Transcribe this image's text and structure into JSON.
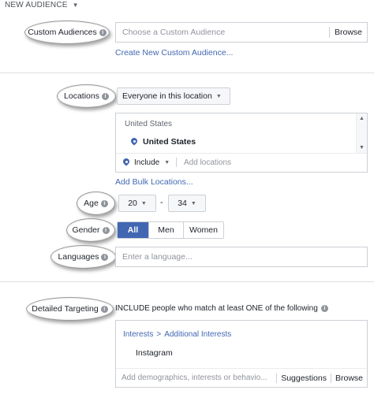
{
  "header": {
    "title": "NEW AUDIENCE"
  },
  "custom_audiences": {
    "label": "Custom Audiences",
    "placeholder": "Choose a Custom Audience",
    "browse": "Browse",
    "create_link": "Create New Custom Audience..."
  },
  "locations": {
    "label": "Locations",
    "mode": "Everyone in this location",
    "group_heading": "United States",
    "selected_item": "United States",
    "include_label": "Include",
    "add_placeholder": "Add locations",
    "bulk_link": "Add Bulk Locations..."
  },
  "age": {
    "label": "Age",
    "min": "20",
    "separator": "-",
    "max": "34"
  },
  "gender": {
    "label": "Gender",
    "options": [
      "All",
      "Men",
      "Women"
    ],
    "selected": "All"
  },
  "languages": {
    "label": "Languages",
    "placeholder": "Enter a language..."
  },
  "detailed_targeting": {
    "label": "Detailed Targeting",
    "description": "INCLUDE people who match at least ONE of the following",
    "breadcrumb_root": "Interests",
    "breadcrumb_sep": ">",
    "breadcrumb_child": "Additional Interests",
    "item": "Instagram",
    "add_placeholder": "Add demographics, interests or behavio...",
    "suggestions": "Suggestions",
    "browse": "Browse"
  },
  "colors": {
    "accent": "#4267b2",
    "border": "#ccd0d5",
    "muted": "#90949c"
  }
}
